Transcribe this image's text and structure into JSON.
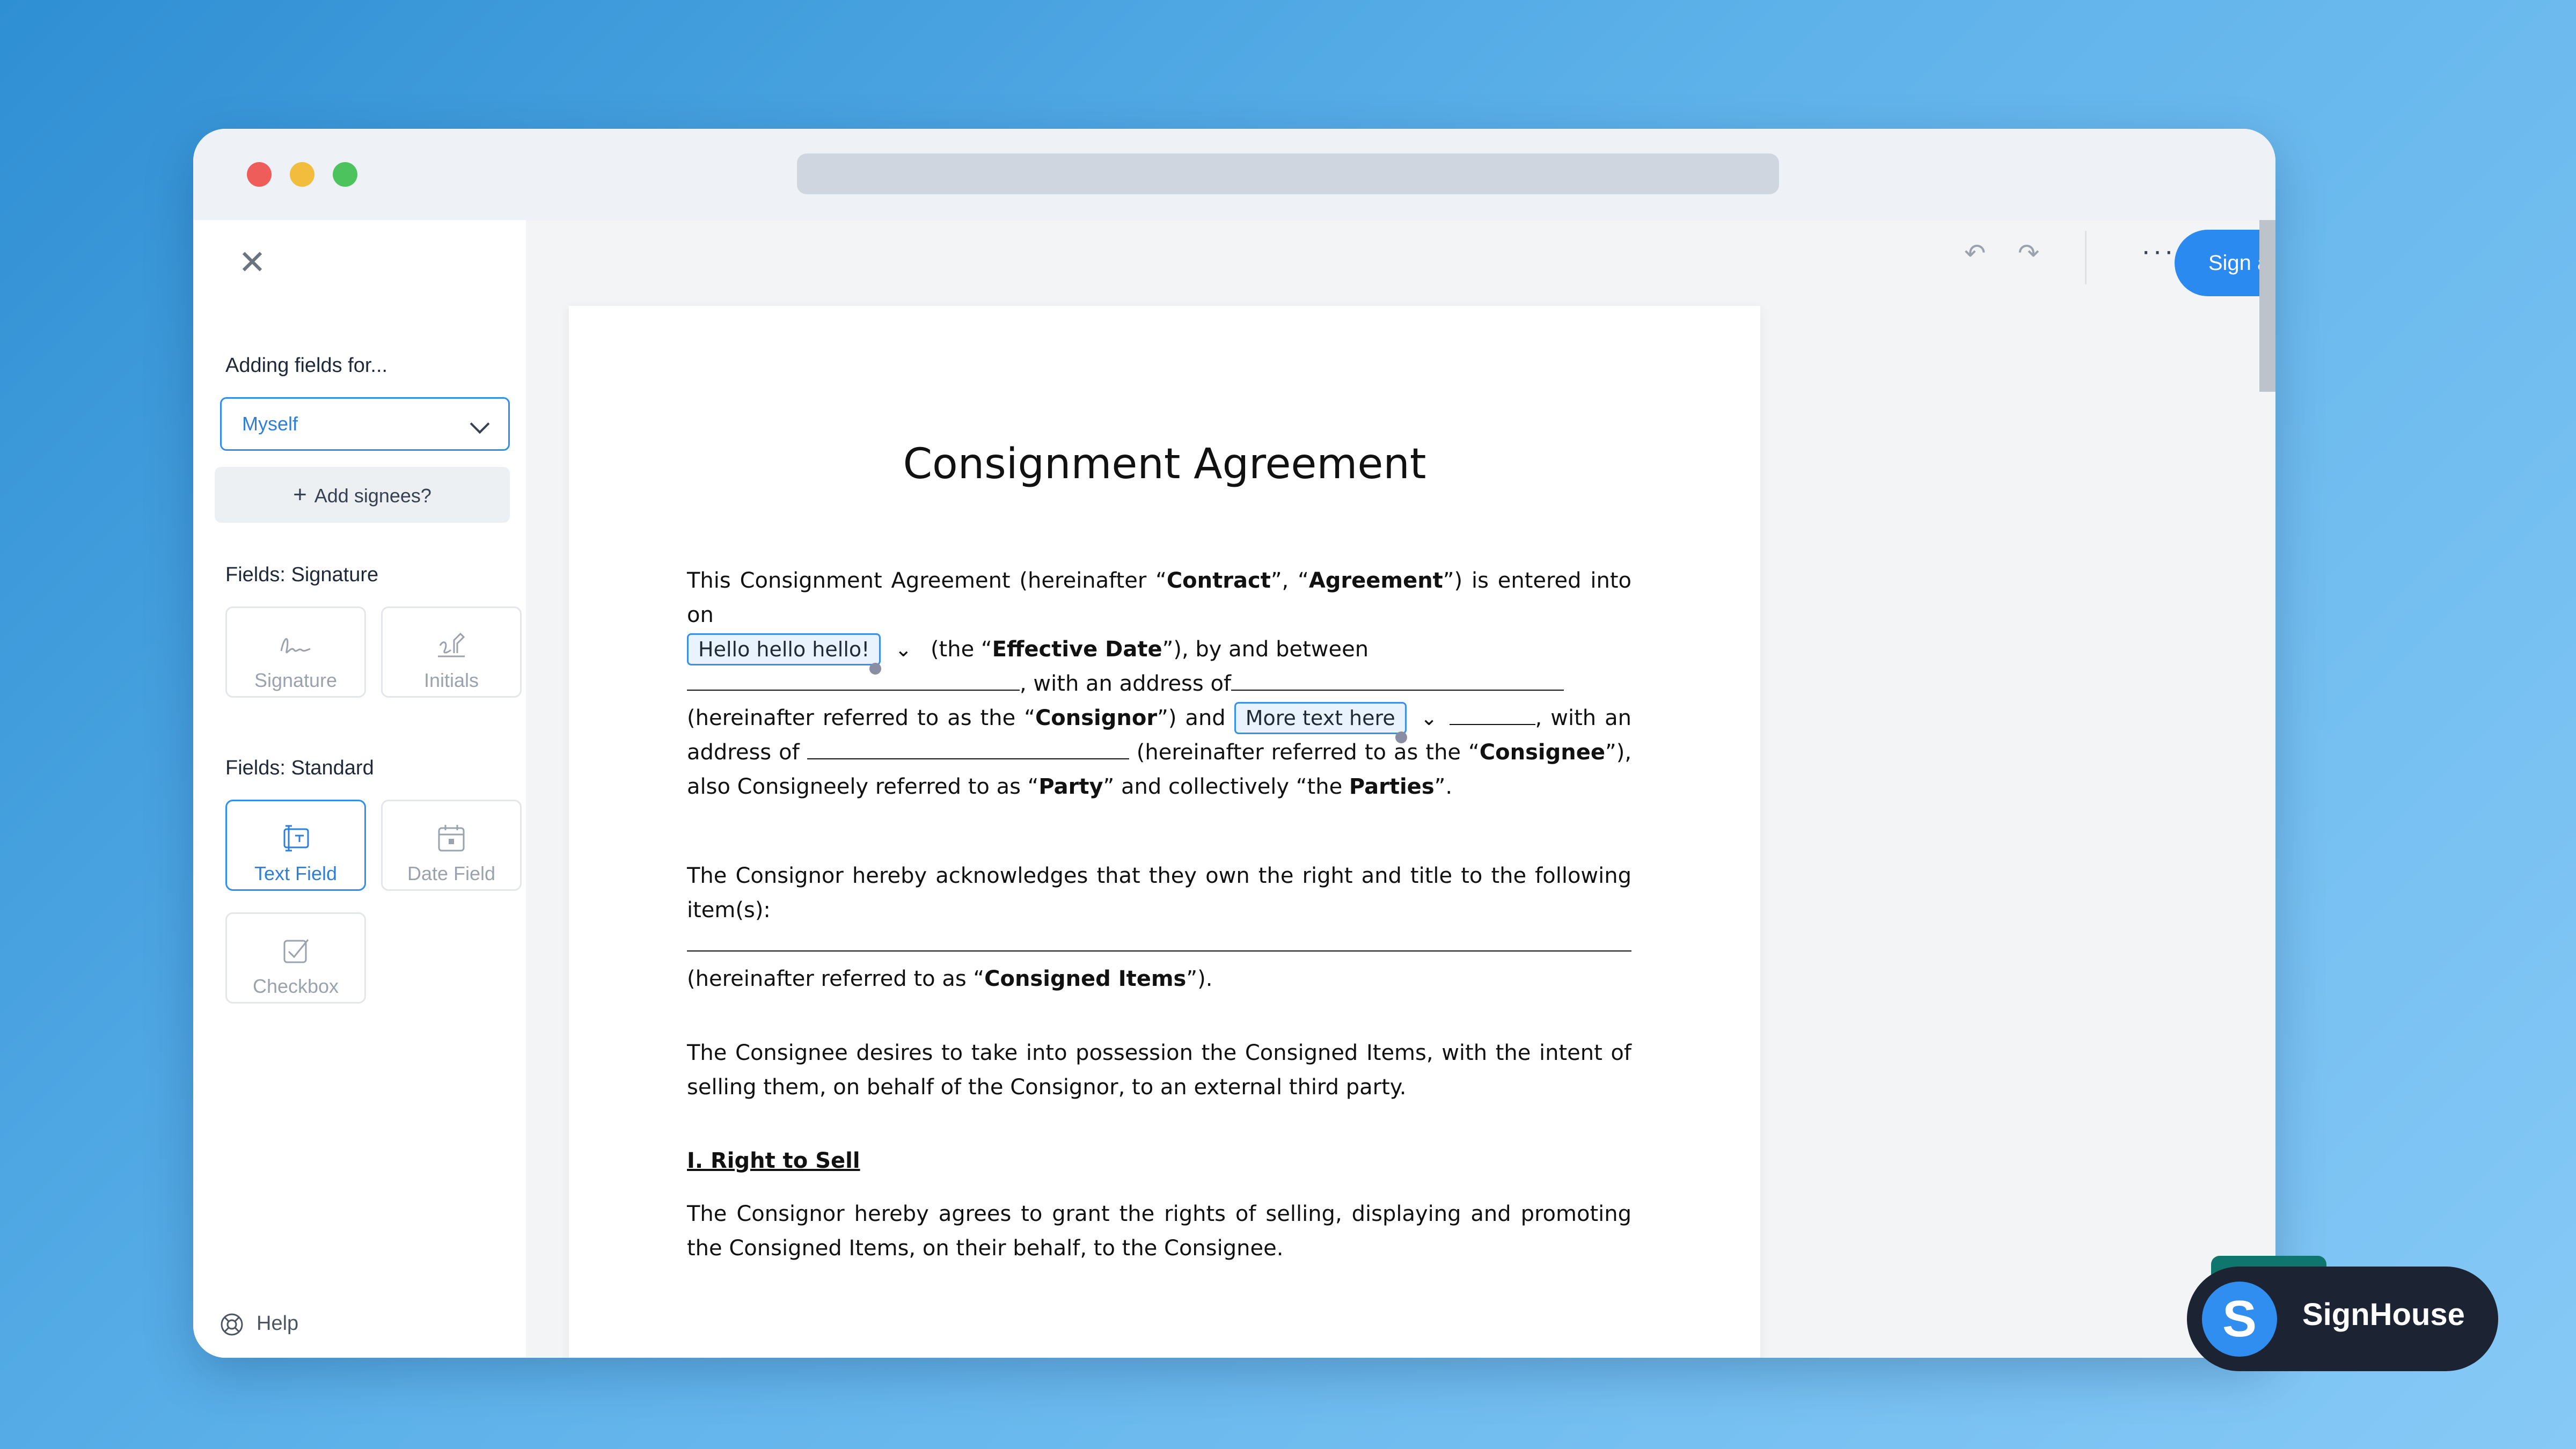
{
  "sidebar": {
    "adding_fields_label": "Adding fields for...",
    "signee_select_value": "Myself",
    "add_signees_label": "Add signees?",
    "signature_section_label": "Fields: Signature",
    "signature_tiles": [
      {
        "label": "Signature",
        "icon": "signature-icon"
      },
      {
        "label": "Initials",
        "icon": "initials-icon"
      }
    ],
    "standard_section_label": "Fields: Standard",
    "standard_tiles": [
      {
        "label": "Text Field",
        "icon": "text-field-icon",
        "active": true
      },
      {
        "label": "Date Field",
        "icon": "calendar-icon"
      },
      {
        "label": "Checkbox",
        "icon": "checkbox-icon"
      }
    ],
    "help_label": "Help"
  },
  "toolbar": {
    "undo_icon": "undo-icon",
    "redo_icon": "redo-icon",
    "more_label": "···",
    "primary_button_label": "Sign and download"
  },
  "document": {
    "title": "Consignment Agreement",
    "p1_a": "This Consignment Agreement (hereinafter “",
    "p1_contract": "Contract",
    "p1_b": "”, “",
    "p1_agreement": "Agreement",
    "p1_c": "”) is entered into on",
    "field1_value": "Hello hello hello!",
    "p1_d": "(the “",
    "p1_effective": "Effective Date",
    "p1_e": "”), by and between",
    "p1_f": ", with an address of",
    "p1_g": "(hereinafter referred to as the “",
    "p1_consignor": "Consignor",
    "p1_h": "”) and",
    "field2_value": "More text here",
    "p1_i": ", with an address of",
    "p1_j": "(hereinafter referred to as the “",
    "p1_consignee": "Consignee",
    "p1_k": "”), also Consigneely referred to as “",
    "p1_party": "Party",
    "p1_l": "” and collectively “the ",
    "p1_parties": "Parties",
    "p1_m": "”.",
    "p2": "The Consignor hereby acknowledges that they own the right and title to the following item(s):",
    "p2_b": "(hereinafter referred to as “",
    "p2_items": "Consigned Items",
    "p2_c": "”).",
    "p3": "The Consignee desires to take into possession the Consigned Items, with the intent of selling them, on behalf of the Consignor, to an external third party.",
    "section1_heading": "I. Right to Sell",
    "p4": "The Consignor hereby agrees to grant the rights of selling, displaying and promoting the Consigned Items, on their behalf, to the Consignee."
  },
  "brand": {
    "logo_letter": "S",
    "name": "SignHouse"
  },
  "colors": {
    "accent": "#2b8aef",
    "brand_dark": "#1c2433"
  }
}
